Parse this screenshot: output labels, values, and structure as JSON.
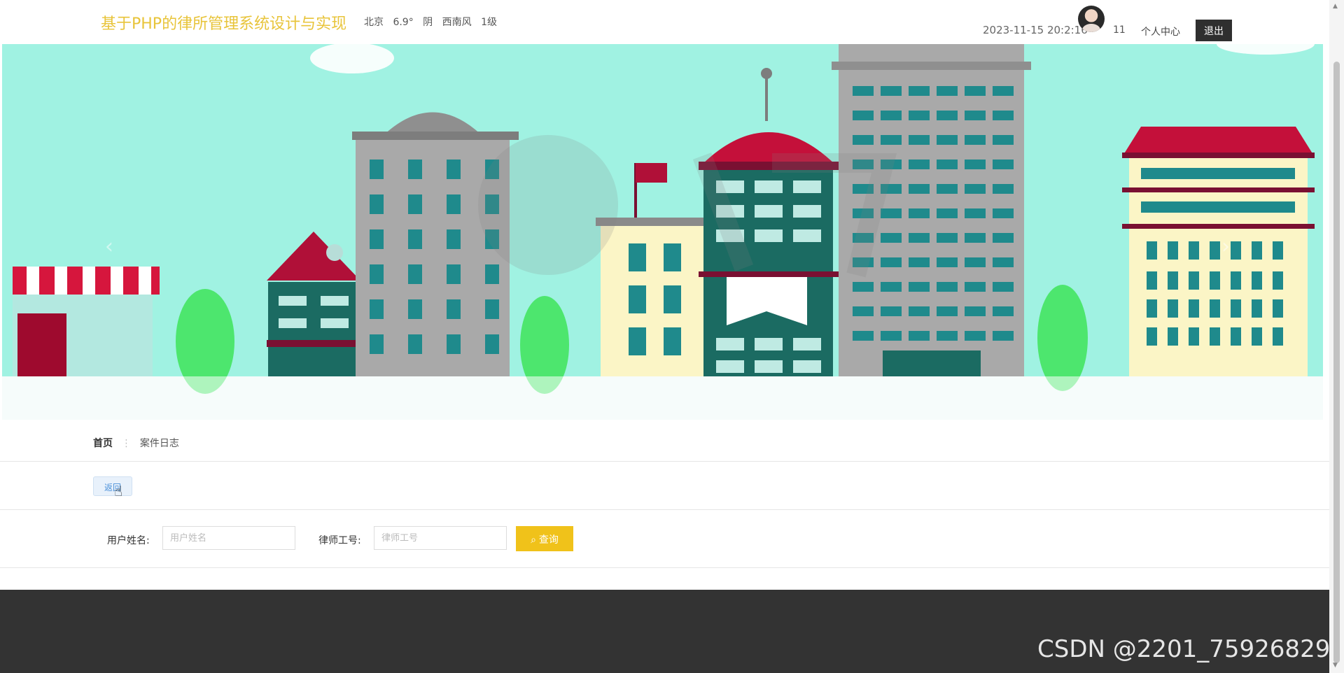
{
  "header": {
    "site_title": "基于PHP的律所管理系统设计与实现",
    "weather": {
      "city": "北京",
      "temp": "6.9°",
      "condition": "阴",
      "wind": "西南风",
      "level": "1级"
    },
    "datetime": "2023-11-15 20:2:16",
    "user_count": "11",
    "personal_center": "个人中心",
    "logout": "退出"
  },
  "breadcrumb": {
    "home": "首页",
    "separator": "⋮",
    "current": "案件日志"
  },
  "actions": {
    "back": "返回"
  },
  "search": {
    "username_label": "用户姓名:",
    "username_placeholder": "用户姓名",
    "lawyer_id_label": "律师工号:",
    "lawyer_id_placeholder": "律师工号",
    "query": "查询"
  },
  "watermark": "CSDN @2201_75926829",
  "colors": {
    "title": "#e8c43a",
    "accent": "#f0c21a",
    "footer": "#333333",
    "logout": "#2f2f2f"
  }
}
